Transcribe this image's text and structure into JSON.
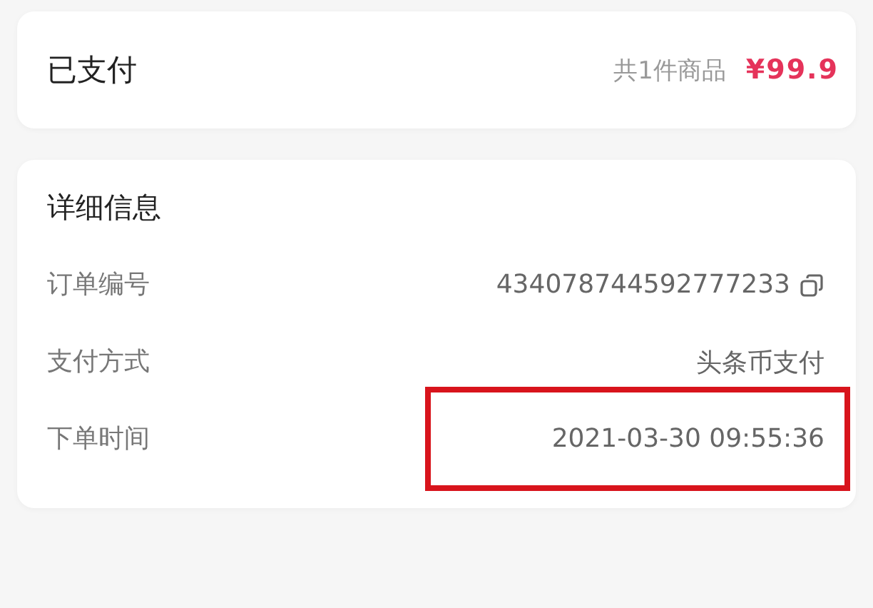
{
  "summary": {
    "status": "已支付",
    "count": "共1件商品",
    "price": "¥99.9"
  },
  "details": {
    "title": "详细信息",
    "rows": [
      {
        "label": "订单编号",
        "value": "434078744592777233",
        "copyable": true,
        "highlighted": false
      },
      {
        "label": "支付方式",
        "value": "头条币支付",
        "copyable": false,
        "highlighted": false
      },
      {
        "label": "下单时间",
        "value": "2021-03-30 09:55:36",
        "copyable": false,
        "highlighted": true
      }
    ]
  }
}
